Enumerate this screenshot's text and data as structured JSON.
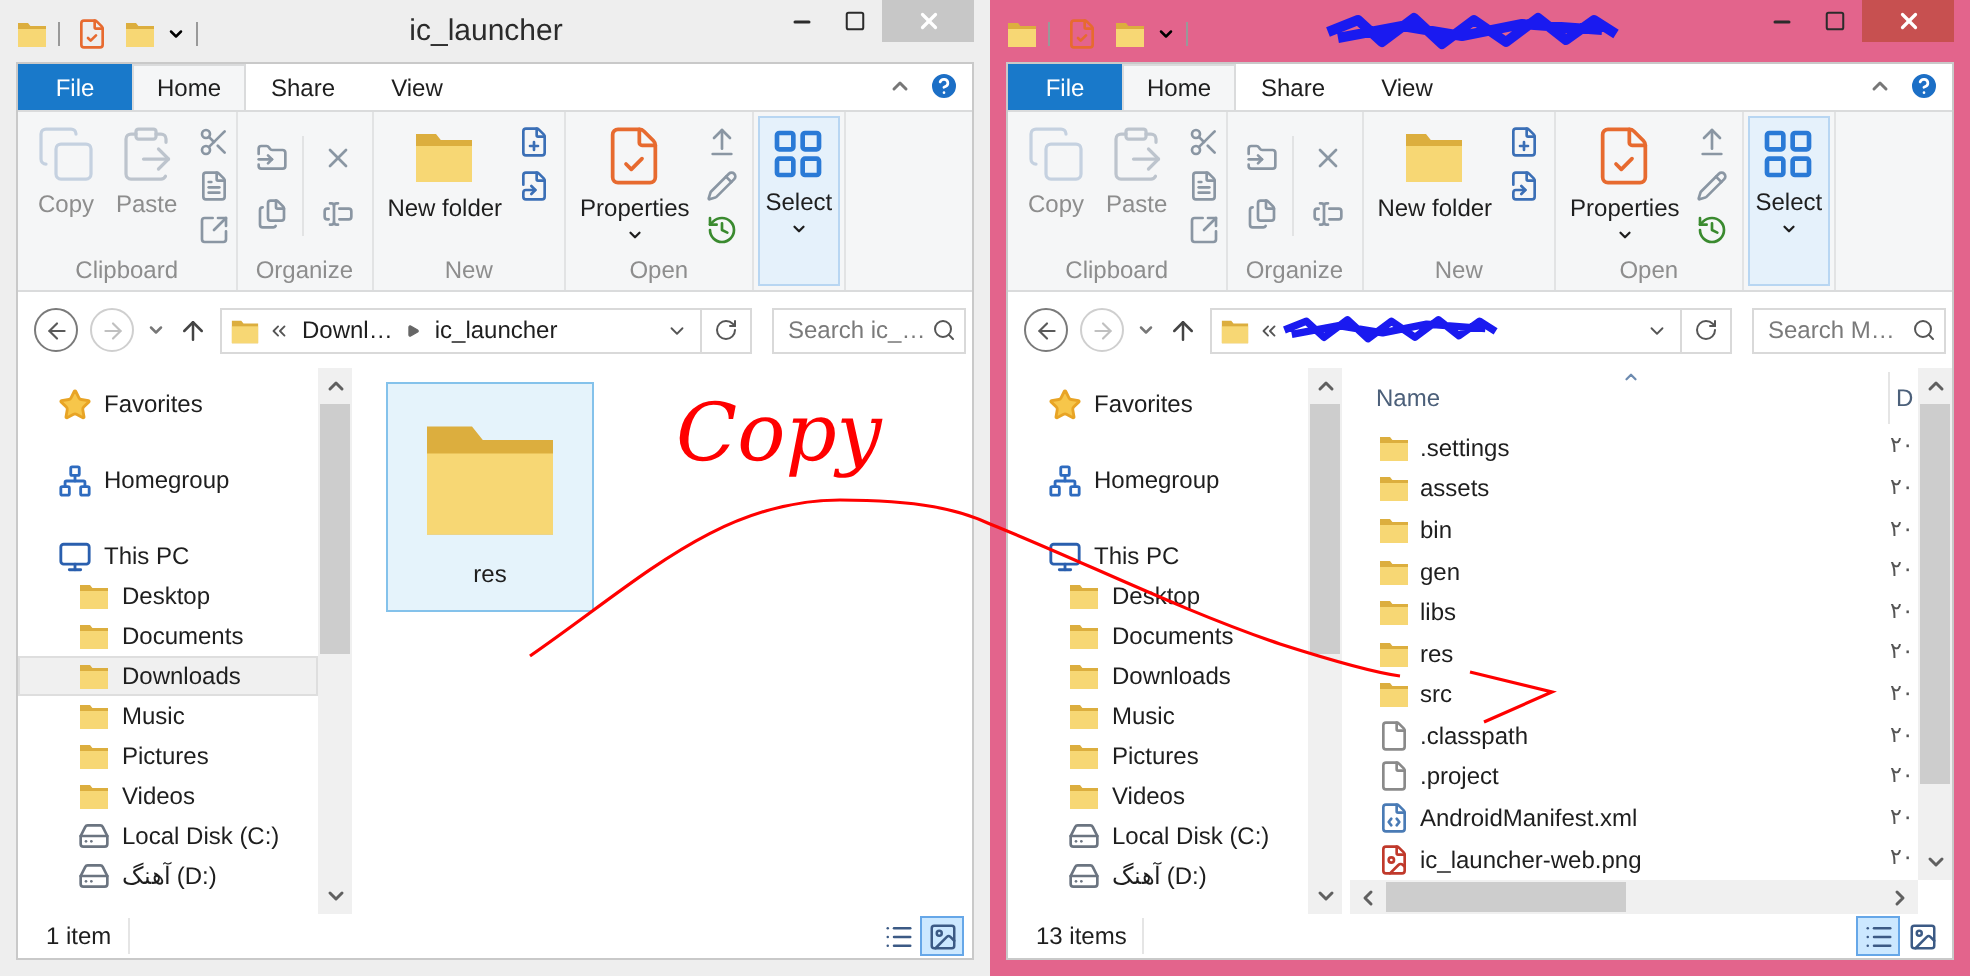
{
  "windows": [
    {
      "active": false,
      "title": "ic_launcher",
      "title_redacted": false,
      "menu_tabs": [
        {
          "label": "File",
          "kind": "file",
          "selected": false
        },
        {
          "label": "Home",
          "kind": "tab",
          "selected": true
        },
        {
          "label": "Share",
          "kind": "tab",
          "selected": false
        },
        {
          "label": "View",
          "kind": "tab",
          "selected": false
        }
      ],
      "ribbon": [
        {
          "kind": "clipboard",
          "label": "Clipboard",
          "buttons": [
            {
              "label": "Copy",
              "disabled": true
            },
            {
              "label": "Paste",
              "disabled": true
            }
          ]
        },
        {
          "kind": "organize",
          "label": "Organize"
        },
        {
          "kind": "new",
          "label": "New",
          "buttons": [
            {
              "label": "New folder",
              "disabled": false
            }
          ]
        },
        {
          "kind": "open",
          "label": "Open",
          "buttons": [
            {
              "label": "Properties",
              "disabled": false
            }
          ]
        },
        {
          "kind": "select",
          "buttons": [
            {
              "label": "Select",
              "disabled": false
            }
          ]
        }
      ],
      "address": {
        "redacted": false,
        "crumbs": [
          "Downl…",
          "ic_launcher"
        ]
      },
      "search": {
        "placeholder": "Search ic_…"
      },
      "nav": [
        {
          "label": "Favorites",
          "kind": "star",
          "selected": false
        },
        {
          "label": "Homegroup",
          "kind": "homegroup",
          "selected": false
        },
        {
          "label": "This PC",
          "kind": "pc",
          "selected": false,
          "children": [
            {
              "label": "Desktop",
              "kind": "folder",
              "selected": false
            },
            {
              "label": "Documents",
              "kind": "folder",
              "selected": false
            },
            {
              "label": "Downloads",
              "kind": "folder",
              "selected": true
            },
            {
              "label": "Music",
              "kind": "folder",
              "selected": false
            },
            {
              "label": "Pictures",
              "kind": "folder",
              "selected": false
            },
            {
              "label": "Videos",
              "kind": "folder",
              "selected": false
            },
            {
              "label": "Local Disk (C:)",
              "kind": "disk",
              "selected": false
            },
            {
              "label": "آهنگ (D:)",
              "kind": "disk",
              "selected": false
            }
          ]
        }
      ],
      "content": {
        "kind": "icons",
        "items": [
          {
            "name": "res",
            "kind": "folder",
            "selected": true
          }
        ]
      },
      "status": "1 item",
      "view_buttons": [
        {
          "kind": "details",
          "selected": false
        },
        {
          "kind": "large_icons",
          "selected": true
        }
      ]
    },
    {
      "active": true,
      "title_redacted": true,
      "menu_tabs": [
        {
          "label": "File",
          "kind": "file",
          "selected": false
        },
        {
          "label": "Home",
          "kind": "tab",
          "selected": true
        },
        {
          "label": "Share",
          "kind": "tab",
          "selected": false
        },
        {
          "label": "View",
          "kind": "tab",
          "selected": false
        }
      ],
      "ribbon": [
        {
          "kind": "clipboard",
          "label": "Clipboard",
          "buttons": [
            {
              "label": "Copy",
              "disabled": true
            },
            {
              "label": "Paste",
              "disabled": true
            }
          ]
        },
        {
          "kind": "organize",
          "label": "Organize"
        },
        {
          "kind": "new",
          "label": "New",
          "buttons": [
            {
              "label": "New folder",
              "disabled": false
            }
          ]
        },
        {
          "kind": "open",
          "label": "Open",
          "buttons": [
            {
              "label": "Properties",
              "disabled": false
            }
          ]
        },
        {
          "kind": "select",
          "buttons": [
            {
              "label": "Select",
              "disabled": false
            }
          ]
        }
      ],
      "address": {
        "redacted": true
      },
      "search": {
        "placeholder": "Search M…"
      },
      "nav": [
        {
          "label": "Favorites",
          "kind": "star",
          "selected": false
        },
        {
          "label": "Homegroup",
          "kind": "homegroup",
          "selected": false
        },
        {
          "label": "This PC",
          "kind": "pc",
          "selected": false,
          "children": [
            {
              "label": "Desktop",
              "kind": "folder",
              "selected": false
            },
            {
              "label": "Documents",
              "kind": "folder",
              "selected": false
            },
            {
              "label": "Downloads",
              "kind": "folder",
              "selected": false
            },
            {
              "label": "Music",
              "kind": "folder",
              "selected": false
            },
            {
              "label": "Pictures",
              "kind": "folder",
              "selected": false
            },
            {
              "label": "Videos",
              "kind": "folder",
              "selected": false
            },
            {
              "label": "Local Disk (C:)",
              "kind": "disk",
              "selected": false
            },
            {
              "label": "آهنگ (D:)",
              "kind": "disk",
              "selected": false
            }
          ]
        }
      ],
      "content": {
        "kind": "details",
        "columns": [
          "Name",
          "D"
        ],
        "items": [
          {
            "name": ".settings",
            "kind": "folder",
            "column_2": "۲۰",
            "selected": false
          },
          {
            "name": "assets",
            "kind": "folder",
            "column_2": "۲۰",
            "selected": false
          },
          {
            "name": "bin",
            "kind": "folder",
            "column_2": "۲۰",
            "selected": false
          },
          {
            "name": "gen",
            "kind": "folder",
            "column_2": "۲۰",
            "selected": false
          },
          {
            "name": "libs",
            "kind": "folder",
            "column_2": "۲۰",
            "selected": false
          },
          {
            "name": "res",
            "kind": "folder",
            "column_2": "۲۰",
            "selected": false
          },
          {
            "name": "src",
            "kind": "folder",
            "column_2": "۲۰",
            "selected": false
          },
          {
            "name": ".classpath",
            "kind": "file",
            "column_2": "۲۰",
            "selected": false
          },
          {
            "name": ".project",
            "kind": "file",
            "column_2": "۲۰",
            "selected": false
          },
          {
            "name": "AndroidManifest.xml",
            "kind": "xml",
            "column_2": "۲۰",
            "selected": false
          },
          {
            "name": "ic_launcher-web.png",
            "kind": "image",
            "column_2": "۲۰",
            "selected": false
          }
        ]
      },
      "status": "13 items",
      "view_buttons": [
        {
          "kind": "details",
          "selected": true
        },
        {
          "kind": "large_icons",
          "selected": false
        }
      ]
    }
  ],
  "annotation": {
    "text": "Copy"
  }
}
